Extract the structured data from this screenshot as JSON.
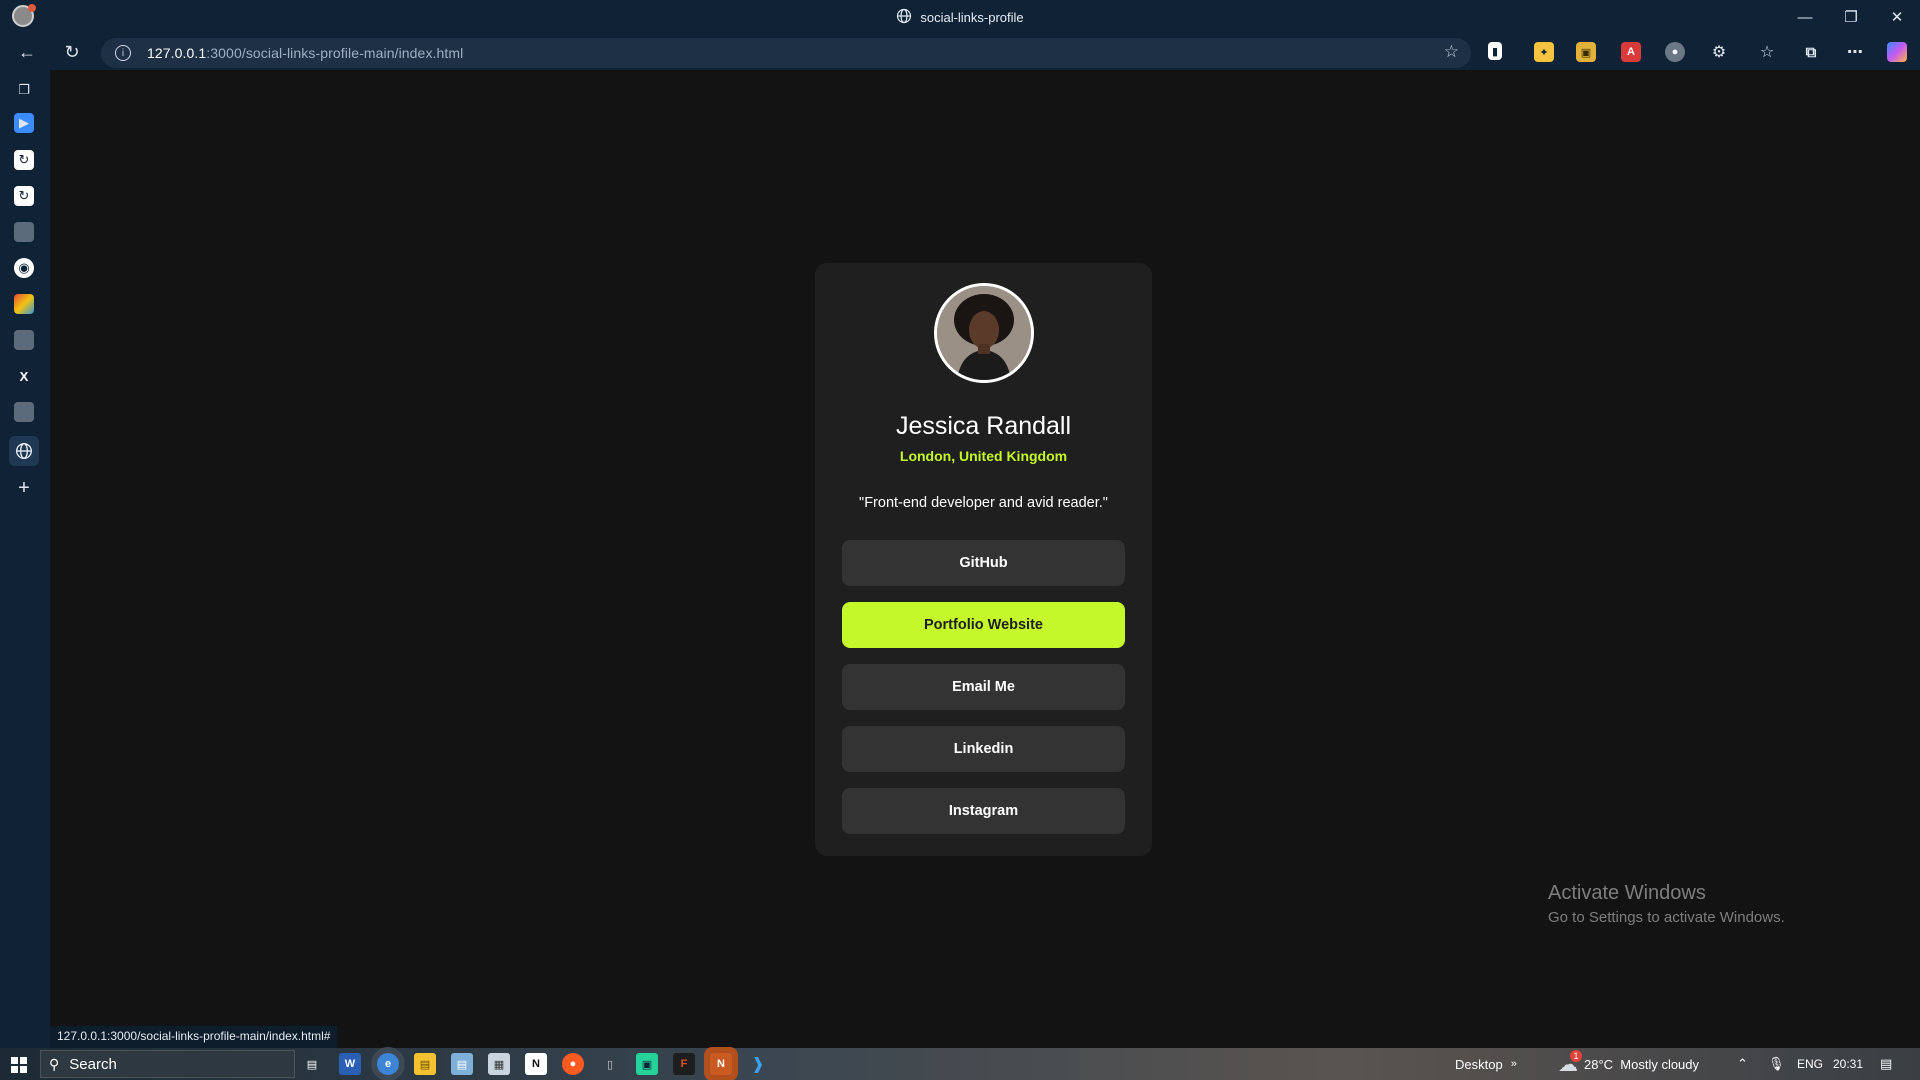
{
  "window": {
    "tab_title": "social-links-profile"
  },
  "address_bar": {
    "url_host": "127.0.0.1",
    "url_rest": ":3000/social-links-profile-main/index.html"
  },
  "profile": {
    "name": "Jessica Randall",
    "location": "London, United Kingdom",
    "bio": "\"Front-end developer and avid reader.\""
  },
  "links": [
    {
      "label": "GitHub",
      "active": false
    },
    {
      "label": "Portfolio Website",
      "active": true
    },
    {
      "label": "Email Me",
      "active": false
    },
    {
      "label": "Linkedin",
      "active": false
    },
    {
      "label": "Instagram",
      "active": false
    }
  ],
  "watermark": {
    "line1": "Activate Windows",
    "line2": "Go to Settings to activate Windows."
  },
  "status_bar": {
    "url": "127.0.0.1:3000/social-links-profile-main/index.html#"
  },
  "taskbar": {
    "search_placeholder": "Search",
    "desktop_label": "Desktop",
    "weather": "28°C  Mostly cloudy",
    "weather_badge": "1",
    "language": "ENG",
    "time": "20:31"
  },
  "colors": {
    "accent": "#c4f82a",
    "card": "#1f1f1f",
    "page_bg": "#131313",
    "link_bg": "#333333",
    "browser_chrome": "#0f2236"
  },
  "icons": [
    "profile-icon",
    "globe-icon",
    "back-icon",
    "refresh-icon",
    "info-icon",
    "star-icon",
    "extensions-icon",
    "favorites-icon",
    "collections-icon",
    "more-icon",
    "copilot-icon",
    "github-icon",
    "x-icon",
    "add-icon",
    "windows-icon",
    "search-icon",
    "weather-icon",
    "mic-icon",
    "notification-icon"
  ]
}
